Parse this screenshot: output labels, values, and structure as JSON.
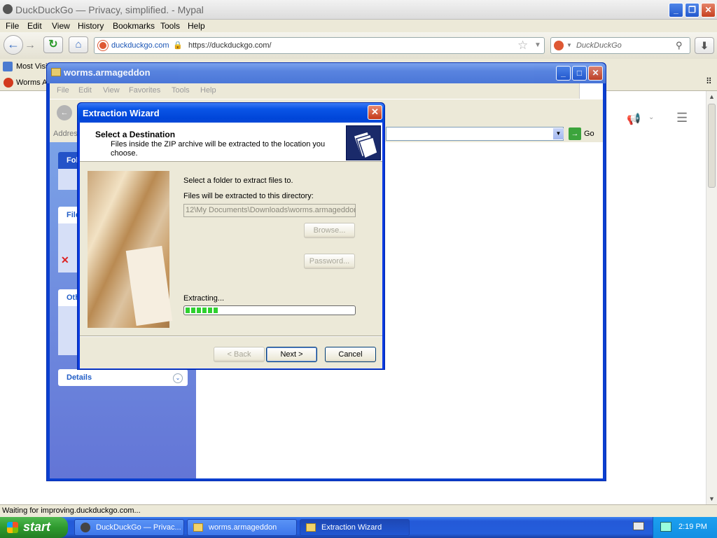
{
  "firefox": {
    "title": "DuckDuckGo — Privacy, simplified. - Mypal",
    "menu": [
      "File",
      "Edit",
      "View",
      "History",
      "Bookmarks",
      "Tools",
      "Help"
    ],
    "url_domain": "duckduckgo.com",
    "url": "https://duckduckgo.com/",
    "search_placeholder": "DuckDuckGo",
    "bookmarks_item": "Most Visi",
    "tab_label": "Worms A",
    "status": "Waiting for improving.duckduckgo.com..."
  },
  "explorer": {
    "title": "worms.armageddon",
    "menu": [
      "File",
      "Edit",
      "View",
      "Favorites",
      "Tools",
      "Help"
    ],
    "address_label": "Addres",
    "go_label": "Go",
    "panels": [
      "Fol",
      "File",
      "Oth",
      "Details"
    ]
  },
  "wizard": {
    "title": "Extraction Wizard",
    "header_title": "Select a Destination",
    "header_desc": "Files inside the ZIP archive will be extracted to the location you choose.",
    "select_label": "Select a folder to extract files to.",
    "dir_label": "Files will be extracted to this directory:",
    "dir_value": "12\\My Documents\\Downloads\\worms.armageddon",
    "browse": "Browse...",
    "password": "Password...",
    "extracting_label": "Extracting...",
    "progress": 0.2,
    "back": "< Back",
    "next": "Next >",
    "cancel": "Cancel"
  },
  "taskbar": {
    "start": "start",
    "tasks": [
      "DuckDuckGo — Privac...",
      "worms.armageddon",
      "Extraction Wizard"
    ],
    "clock": "2:19 PM"
  }
}
